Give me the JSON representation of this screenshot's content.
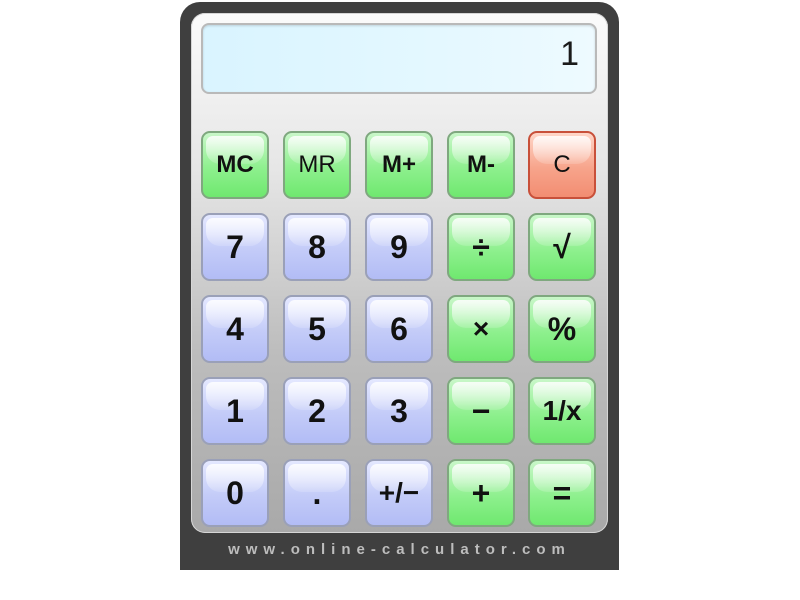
{
  "display": {
    "value": "1"
  },
  "buttons": {
    "mc": "MC",
    "mr": "MR",
    "m_plus": "M+",
    "m_minus": "M-",
    "clear": "C",
    "seven": "7",
    "eight": "8",
    "nine": "9",
    "divide": "÷",
    "sqrt": "√",
    "four": "4",
    "five": "5",
    "six": "6",
    "multiply": "×",
    "percent": "%",
    "one": "1",
    "two": "2",
    "three": "3",
    "minus": "−",
    "reciprocal": "1/x",
    "zero": "0",
    "decimal": ".",
    "plus_minus": "+/−",
    "plus": "+",
    "equals": "="
  },
  "footer": {
    "text": "www.online-calculator.com"
  },
  "colors": {
    "frame": "#3f3f3f",
    "display_bg": "#e4f8ff",
    "memory_op_button": "#8ef08e",
    "digit_button": "#c3cbf8",
    "clear_button": "#f7a48b"
  }
}
